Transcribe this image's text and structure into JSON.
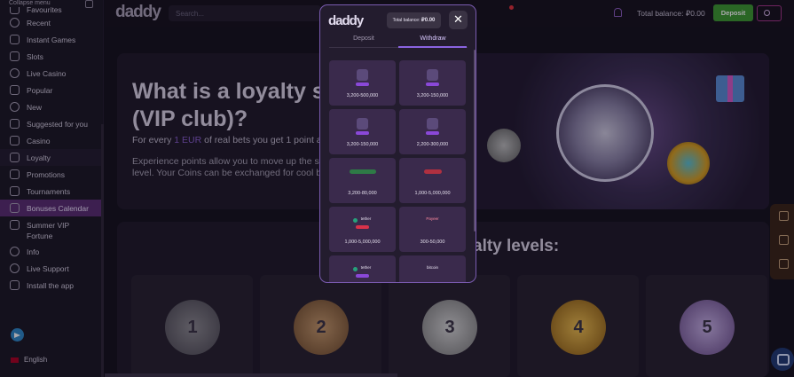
{
  "sidebar": {
    "collapse_label": "Collapse menu",
    "items": [
      {
        "label": "Favourites",
        "icon": "star-icon"
      },
      {
        "label": "Recent",
        "icon": "clock-icon"
      },
      {
        "label": "Instant Games",
        "icon": "rocket-icon"
      },
      {
        "label": "Slots",
        "icon": "diamond-icon"
      },
      {
        "label": "Live Casino",
        "icon": "live-icon"
      },
      {
        "label": "Popular",
        "icon": "fire-icon"
      },
      {
        "label": "New",
        "icon": "new-icon"
      },
      {
        "label": "Suggested for you",
        "icon": "thumbs-up-icon"
      },
      {
        "label": "Casino",
        "icon": "casino-icon"
      },
      {
        "label": "Loyalty",
        "icon": "crown-icon"
      },
      {
        "label": "Promotions",
        "icon": "megaphone-icon"
      },
      {
        "label": "Tournaments",
        "icon": "trophy-icon"
      },
      {
        "label": "Bonuses Calendar",
        "icon": "calendar-icon"
      },
      {
        "label": "Summer VIP Fortune",
        "icon": "ticket-icon"
      },
      {
        "label": "Info",
        "icon": "info-icon"
      },
      {
        "label": "Live Support",
        "icon": "headset-icon"
      },
      {
        "label": "Install the app",
        "icon": "download-icon"
      }
    ],
    "active_item": "Bonuses Calendar",
    "telegram_icon": "telegram-icon",
    "language": "English"
  },
  "header": {
    "logo": "daddy",
    "search_placeholder": "Search...",
    "total_balance_label": "Total balance: ₽0.00",
    "deposit_label": "Deposit"
  },
  "hero": {
    "title": "What is a loyalty s (VIP club)?",
    "para1_prefix": "For every ",
    "para1_highlight": "1 EUR",
    "para1_suffix": " of real bets you get 1 point and",
    "para2": "Experience points allow you to move up the s level. Your Coins can be exchanged for cool b"
  },
  "levels": {
    "title": "alty levels:",
    "medals": [
      "1",
      "2",
      "3",
      "4",
      "5"
    ]
  },
  "modal": {
    "logo": "daddy",
    "balance_label": "Total balance:",
    "balance_value": "₽0.00",
    "close": "✕",
    "tabs": [
      "Deposit",
      "Withdraw"
    ],
    "active_tab": "Withdraw",
    "methods": [
      {
        "brand": "",
        "range": "3,200-500,000"
      },
      {
        "brand": "",
        "range": "3,200-150,000"
      },
      {
        "brand": "",
        "range": "3,200-150,000"
      },
      {
        "brand": "",
        "range": "2,200-300,000"
      },
      {
        "brand": "",
        "range": "3,200-80,000"
      },
      {
        "brand": "",
        "range": "1,000-5,000,000"
      },
      {
        "brand": "tether",
        "range": "1,000-5,000,000"
      },
      {
        "brand": "Payeer",
        "range": "300-50,000"
      },
      {
        "brand": "tether",
        "range": ""
      },
      {
        "brand": "bitcoin",
        "range": ""
      }
    ]
  },
  "colors": {
    "accent": "#8a63e0",
    "deposit_green": "#3c9a30",
    "sidebar_active": "#5a2d72"
  }
}
